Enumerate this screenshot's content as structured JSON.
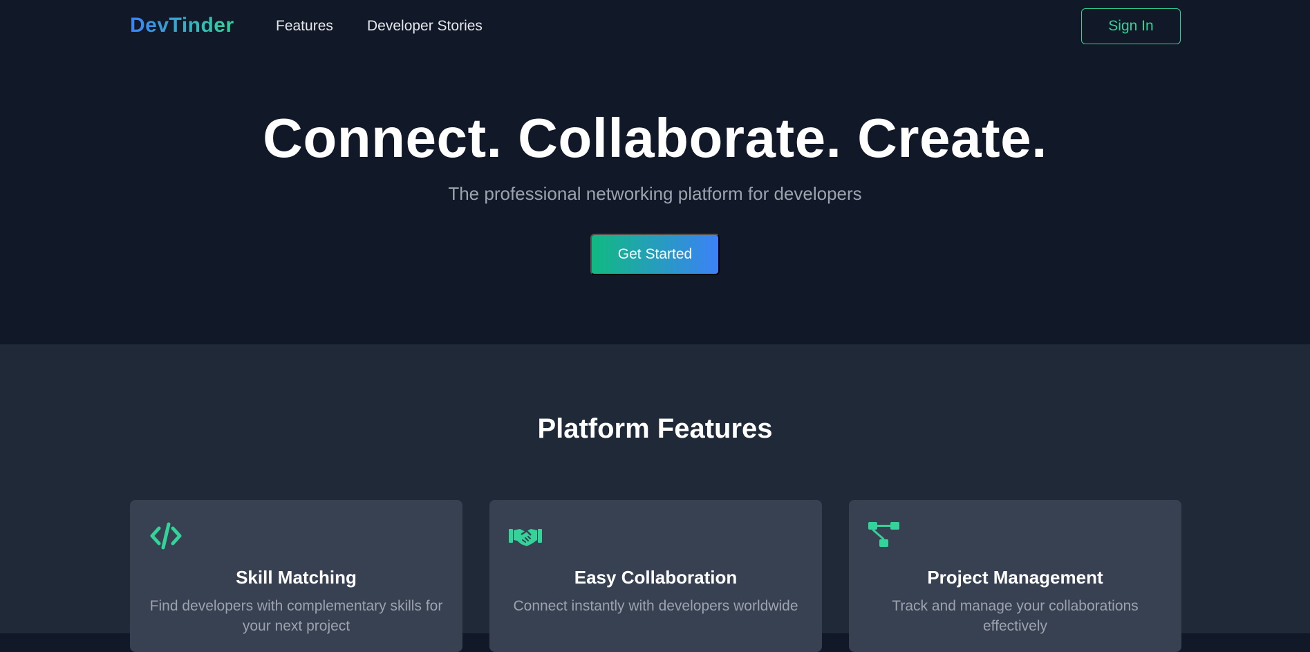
{
  "nav": {
    "logo": "DevTinder",
    "links": [
      {
        "label": "Features"
      },
      {
        "label": "Developer Stories"
      }
    ],
    "signin_label": "Sign In"
  },
  "hero": {
    "title": "Connect. Collaborate. Create.",
    "subtitle": "The professional networking platform for developers",
    "cta_label": "Get Started"
  },
  "features": {
    "title": "Platform Features",
    "cards": [
      {
        "icon": "code-icon",
        "title": "Skill Matching",
        "desc": "Find developers with complementary skills for your next project"
      },
      {
        "icon": "handshake-icon",
        "title": "Easy Collaboration",
        "desc": "Connect instantly with developers worldwide"
      },
      {
        "icon": "project-diagram-icon",
        "title": "Project Management",
        "desc": "Track and manage your collaborations effectively"
      }
    ]
  },
  "colors": {
    "background": "#111827",
    "section": "#1f2937",
    "card": "#374151",
    "accent": "#34d399",
    "gradient_start": "#10b981",
    "gradient_end": "#3b82f6"
  }
}
